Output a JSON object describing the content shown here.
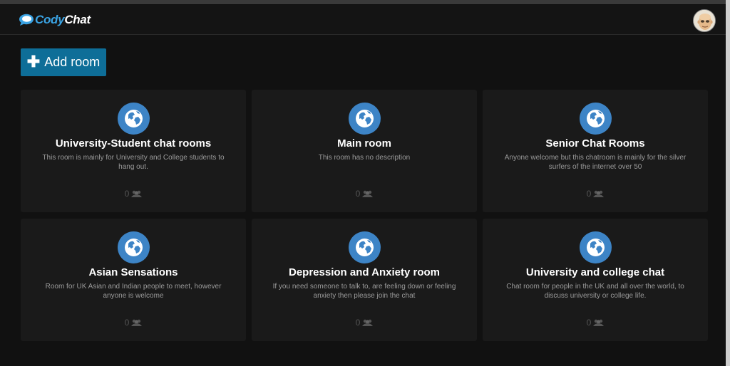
{
  "app": {
    "logo_part1": "Cody",
    "logo_part2": "Chat",
    "brand_color": "#3aa3e3"
  },
  "toolbar": {
    "add_room_label": "Add room",
    "add_room_icon": "plus-icon",
    "accent_color": "#0e6e98"
  },
  "rooms": [
    {
      "name": "University-Student chat rooms",
      "description": "This room is mainly for University and College students to hang out.",
      "users": "0",
      "icon": "globe-icon"
    },
    {
      "name": "Main room",
      "description": "This room has no description",
      "users": "0",
      "icon": "globe-icon"
    },
    {
      "name": "Senior Chat Rooms",
      "description": "Anyone welcome but this chatroom is mainly for the silver surfers of the internet over 50",
      "users": "0",
      "icon": "globe-icon"
    },
    {
      "name": "Asian Sensations",
      "description": "Room for UK Asian and Indian people to meet, however anyone is welcome",
      "users": "0",
      "icon": "globe-icon"
    },
    {
      "name": "Depression and Anxiety room",
      "description": "If you need someone to talk to, are feeling down or feeling anxiety then please join the chat",
      "users": "0",
      "icon": "globe-icon"
    },
    {
      "name": "University and college chat",
      "description": "Chat room for people in the UK and all over the world, to discuss university or college life.",
      "users": "0",
      "icon": "globe-icon"
    }
  ]
}
